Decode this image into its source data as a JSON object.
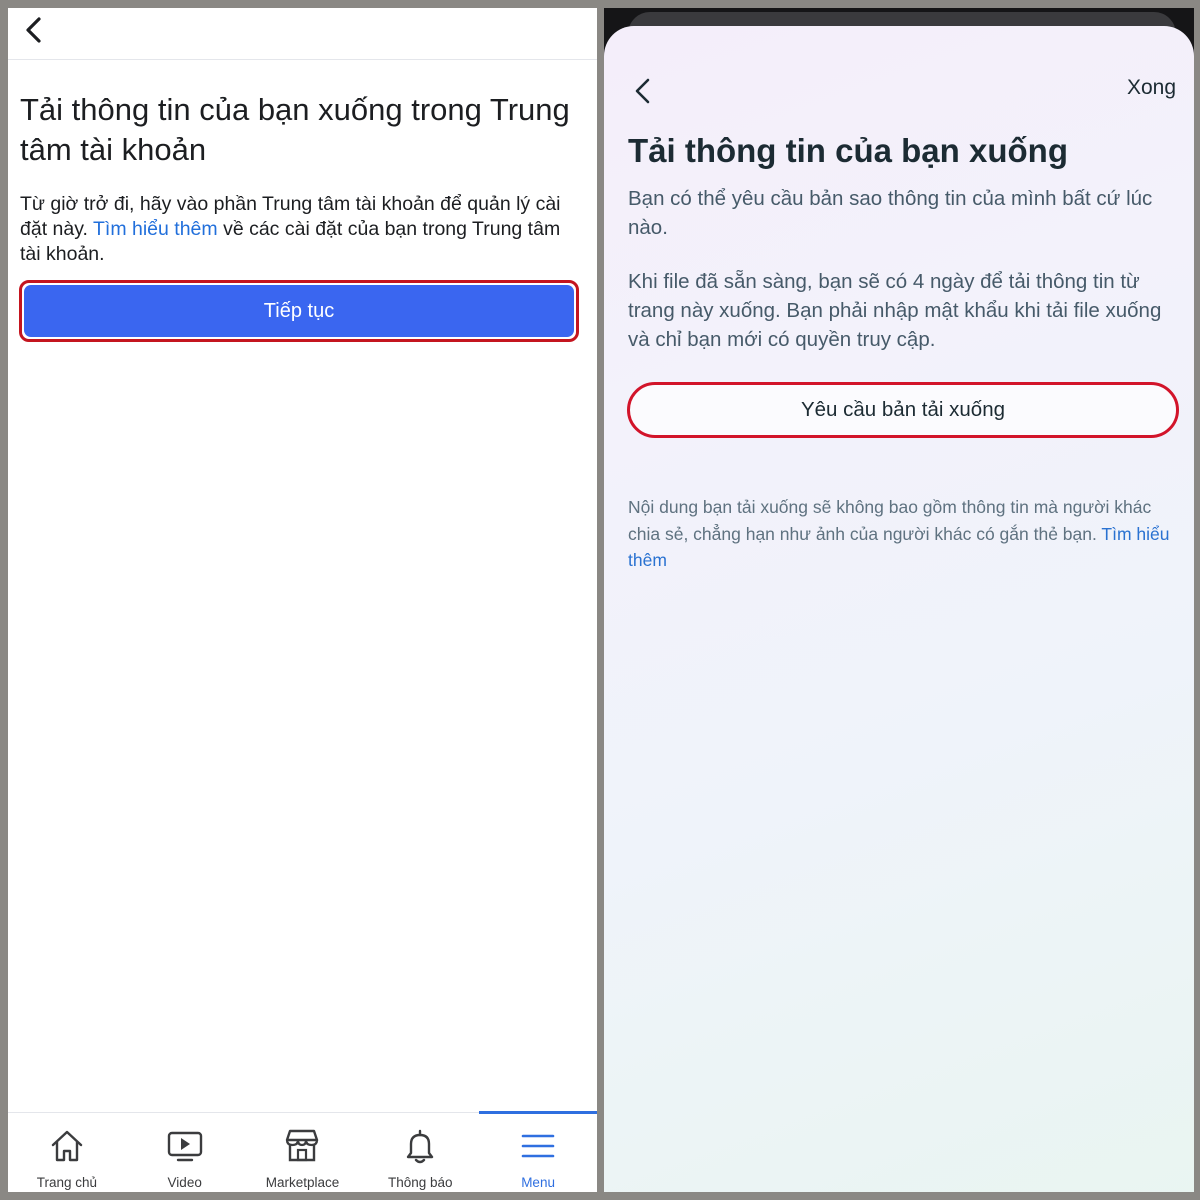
{
  "left": {
    "title": "Tải thông tin của bạn xuống trong Trung tâm tài khoản",
    "description_before_link": "Từ giờ trở đi, hãy vào phần Trung tâm tài khoản để quản lý cài đặt này. ",
    "learn_more_link": "Tìm hiểu thêm",
    "description_after_link": " về các cài đặt của bạn trong Trung tâm tài khoản.",
    "continue_label": "Tiếp tục",
    "tabs": [
      {
        "label": "Trang chủ",
        "icon": "home-icon"
      },
      {
        "label": "Video",
        "icon": "video-icon"
      },
      {
        "label": "Marketplace",
        "icon": "marketplace-icon"
      },
      {
        "label": "Thông báo",
        "icon": "bell-icon"
      },
      {
        "label": "Menu",
        "icon": "menu-icon",
        "active": true
      }
    ],
    "accent_color": "#3a66f0",
    "highlight_color": "#c4151f"
  },
  "right": {
    "done_label": "Xong",
    "title": "Tải thông tin của bạn xuống",
    "paragraph1": "Bạn có thể yêu cầu bản sao thông tin của mình bất cứ lúc nào.",
    "paragraph2": "Khi file đã sẵn sàng, bạn sẽ có 4 ngày để tải thông tin từ trang này xuống. Bạn phải nhập mật khẩu khi tải file xuống và chỉ bạn mới có quyền truy cập.",
    "request_button_label": "Yêu cầu bản tải xuống",
    "note_text": "Nội dung bạn tải xuống sẽ không bao gồm thông tin mà người khác chia sẻ, chẳng hạn như ảnh của người khác có gắn thẻ bạn. ",
    "note_link": "Tìm hiểu thêm",
    "link_color": "#2a72d1"
  }
}
